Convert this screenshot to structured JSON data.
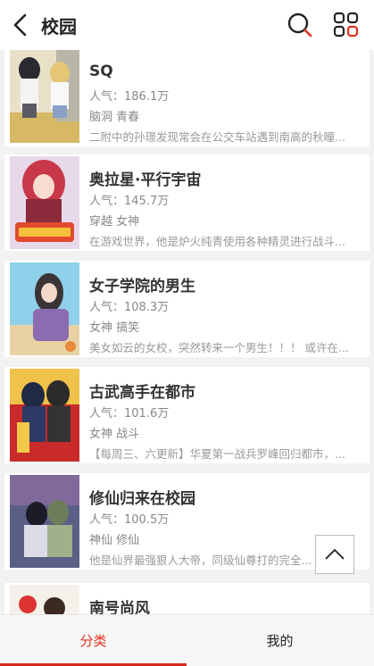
{
  "header": {
    "title": "校园",
    "back_icon": "chevron-left-icon",
    "search_icon": "search-icon",
    "grid_icon": "grid-icon"
  },
  "books": [
    {
      "title": "SQ",
      "popularity": "人气：186.1万",
      "tags": "脑洞 青春",
      "desc": "二附中的孙璟发现常会在公交车站遇到南高的秋瞳..."
    },
    {
      "title": "奥拉星·平行宇宙",
      "popularity": "人气：145.7万",
      "tags": "穿越 女神",
      "desc": "在游戏世界，他是炉火纯青使用各种精灵进行战斗..."
    },
    {
      "title": "女子学院的男生",
      "popularity": "人气：108.3万",
      "tags": "女神 搞笑",
      "desc": "美女如云的女校，突然转来一个男生！！！ 或许在..."
    },
    {
      "title": "古武高手在都市",
      "popularity": "人气：101.6万",
      "tags": "女神 战斗",
      "desc": "【每周三、六更新】华夏第一战兵罗峰回归都市，..."
    },
    {
      "title": "修仙归来在校园",
      "popularity": "人气：100.5万",
      "tags": "神仙 修仙",
      "desc": "他是仙界最强狠人大帝，同级仙尊打的完全..."
    },
    {
      "title": "南号尚风",
      "popularity": "",
      "tags": "",
      "desc": ""
    }
  ],
  "tabbar": {
    "category": "分类",
    "mine": "我的",
    "active_color": "#e0301e"
  },
  "scroll_top_icon": "chevron-up-icon"
}
